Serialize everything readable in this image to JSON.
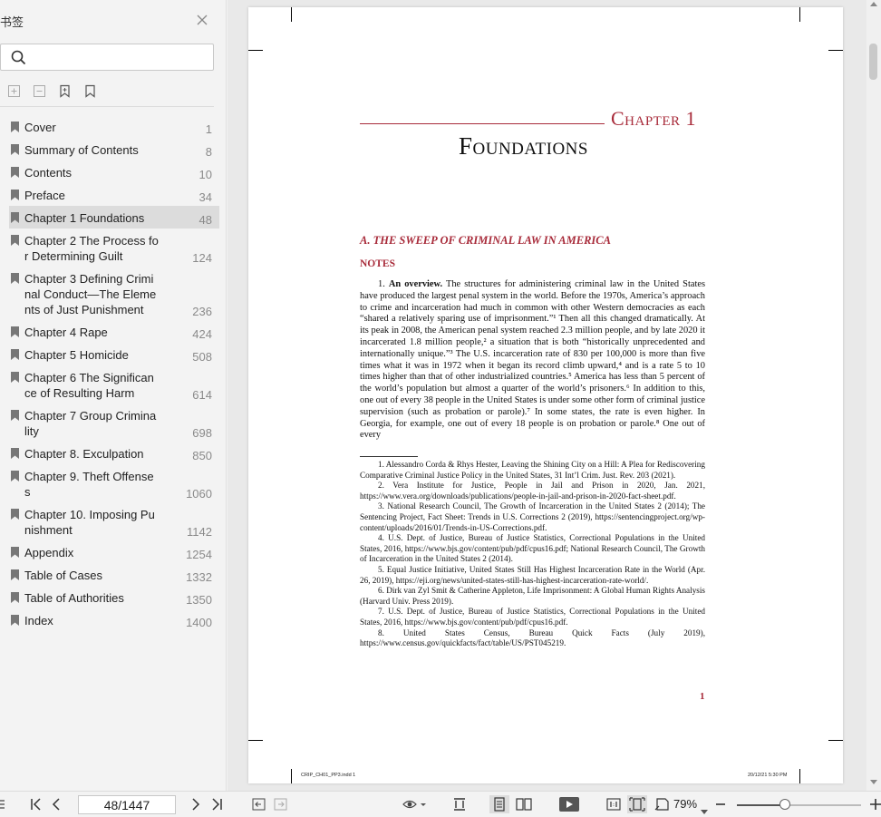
{
  "sidebar": {
    "title": "书签",
    "search": {
      "placeholder": "",
      "value": ""
    },
    "bookmarks": [
      {
        "label": "Cover",
        "page": "1"
      },
      {
        "label": "Summary of Contents",
        "page": "8"
      },
      {
        "label": "Contents",
        "page": "10"
      },
      {
        "label": "Preface",
        "page": "34"
      },
      {
        "label": "Chapter 1  Foundations",
        "page": "48",
        "active": true
      },
      {
        "label": "Chapter 2  The Process for Determining Guilt",
        "page": "124"
      },
      {
        "label": "Chapter 3  Defining Criminal Conduct—The Elements of  Just Punishment",
        "page": "236"
      },
      {
        "label": "Chapter 4  Rape",
        "page": "424"
      },
      {
        "label": "Chapter 5  Homicide",
        "page": "508"
      },
      {
        "label": "Chapter 6  The Significance of Resulting Harm",
        "page": "614"
      },
      {
        "label": "Chapter 7  Group Criminality",
        "page": "698"
      },
      {
        "label": "Chapter 8.  Exculpation",
        "page": "850"
      },
      {
        "label": "Chapter 9.  Theft Offenses",
        "page": "1060"
      },
      {
        "label": "Chapter 10.  Imposing Punishment",
        "page": "1142"
      },
      {
        "label": "Appendix",
        "page": "1254"
      },
      {
        "label": "Table of Cases",
        "page": "1332"
      },
      {
        "label": "Table of Authorities",
        "page": "1350"
      },
      {
        "label": "Index",
        "page": "1400"
      }
    ]
  },
  "document": {
    "chapter_label": "Chapter 1",
    "chapter_title": "Foundations",
    "section_heading": "A.    THE SWEEP OF CRIMINAL LAW IN AMERICA",
    "notes_heading": "NOTES",
    "para_lead": "1. ",
    "para_bold": "An overview.",
    "para_body": " The structures for administering criminal law in the United States have produced the largest penal system in the world. Before the 1970s, America’s approach to crime and incarceration had much in common with other Western democracies as each “shared a relatively sparing use of imprisonment.”¹ Then all this changed dramatically. At its peak in 2008, the American penal system reached 2.3 million people, and by late 2020 it incarcerated 1.8 million people,² a situation that is both “historically unprecedented and internationally unique.”³ The U.S. incarceration rate of 830 per 100,000 is more than five times what it was in 1972 when it began its record climb upward,⁴ and is a rate 5 to 10 times higher than that of other industrialized countries.⁵ America has less than 5 percent of the world’s population but almost a quarter of the world’s prisoners.⁶ In addition to this, one out of every 38 people in the United States is under some other form of criminal justice supervision (such as probation or parole).⁷ In some states, the rate is even higher. In Georgia, for example, one out of every 18 people is on probation or parole.⁸ One out of every",
    "footnotes": [
      "1. Alessandro Corda & Rhys Hester, Leaving the Shining City on a Hill: A Plea for Rediscovering Comparative Criminal Justice Policy in the United States, 31 Int’l Crim. Just. Rev. 203 (2021).",
      "2. Vera Institute for Justice, People in Jail and Prison in 2020, Jan. 2021, https://www.vera.org/downloads/publications/people-in-jail-and-prison-in-2020-fact-sheet.pdf.",
      "3. National Research Council, The Growth of Incarceration in the United States 2 (2014); The Sentencing Project, Fact Sheet: Trends in U.S. Corrections 2 (2019), https://sentencingproject.org/wp-content/uploads/2016/01/Trends-in-US-Corrections.pdf.",
      "4. U.S. Dept. of Justice, Bureau of Justice Statistics, Correctional Populations in the United States, 2016, https://www.bjs.gov/content/pub/pdf/cpus16.pdf; National Research Council, The Growth of Incarceration in the United States 2 (2014).",
      "5. Equal Justice Initiative, United States Still Has Highest Incarceration Rate in the World (Apr. 26, 2019), https://eji.org/news/united-states-still-has-highest-incarceration-rate-world/.",
      "6. Dirk van Zyl Smit & Catherine Appleton, Life Imprisonment: A Global Human Rights Analysis (Harvard Univ. Press 2019).",
      "7. U.S. Dept. of Justice, Bureau of Justice Statistics, Correctional Populations in the United States, 2016, https://www.bjs.gov/content/pub/pdf/cpus16.pdf.",
      "8. United States Census, Bureau Quick Facts (July 2019), https://www.census.gov/quickfacts/fact/table/US/PST045219."
    ],
    "page_number": "1",
    "slug_left": "CRIP_CH01_PP3.indd   1",
    "slug_right": "20/12/21   5:30 PM"
  },
  "toolbar": {
    "page_display": "48/1447",
    "zoom": "79%"
  }
}
